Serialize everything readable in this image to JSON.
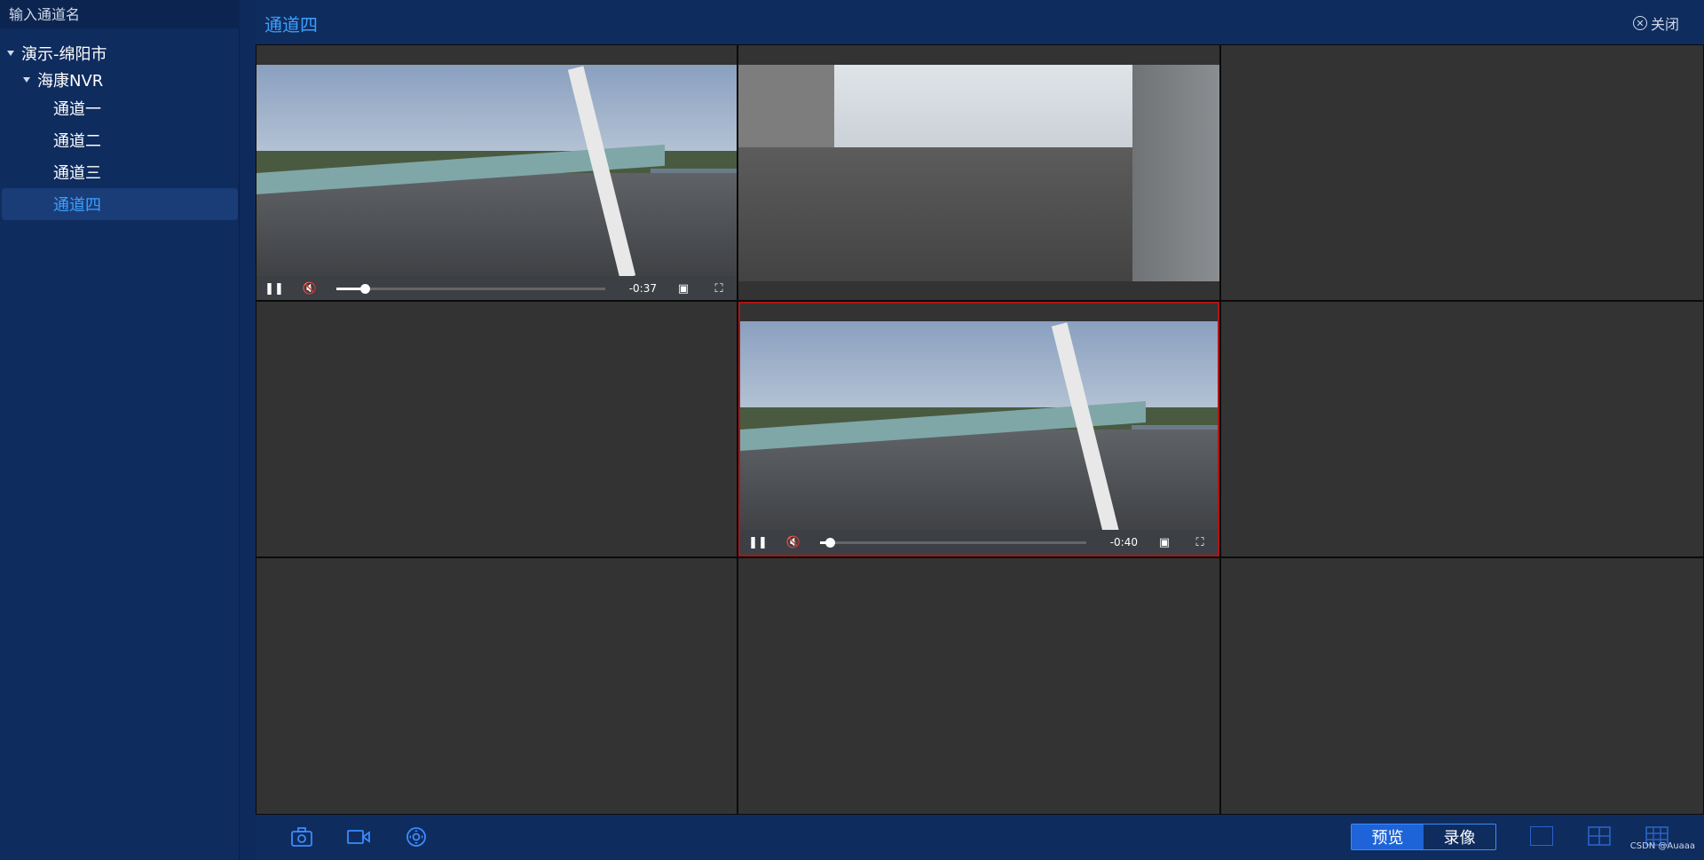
{
  "sidebar": {
    "search_placeholder": "输入通道名",
    "tree": [
      {
        "label": "演示-绵阳市",
        "level": 0,
        "expanded": true
      },
      {
        "label": "海康NVR",
        "level": 1,
        "expanded": true
      },
      {
        "label": "通道一",
        "level": 2
      },
      {
        "label": "通道二",
        "level": 2
      },
      {
        "label": "通道三",
        "level": 2
      },
      {
        "label": "通道四",
        "level": 2,
        "selected": true
      }
    ]
  },
  "header": {
    "title": "通道四",
    "close_label": "关闭"
  },
  "grid": {
    "players": [
      {
        "time": "-0:37",
        "progress": 0.1
      },
      {
        "time": "-0:40",
        "progress": 0.03
      }
    ]
  },
  "bottombar": {
    "modes": [
      "预览",
      "录像"
    ],
    "active_mode": "预览",
    "watermark": "CSDN @Auaaa"
  },
  "colors": {
    "accent": "#3aa0ff",
    "background": "#0e2a5c",
    "cell": "#333333",
    "active_border": "#b01414"
  }
}
